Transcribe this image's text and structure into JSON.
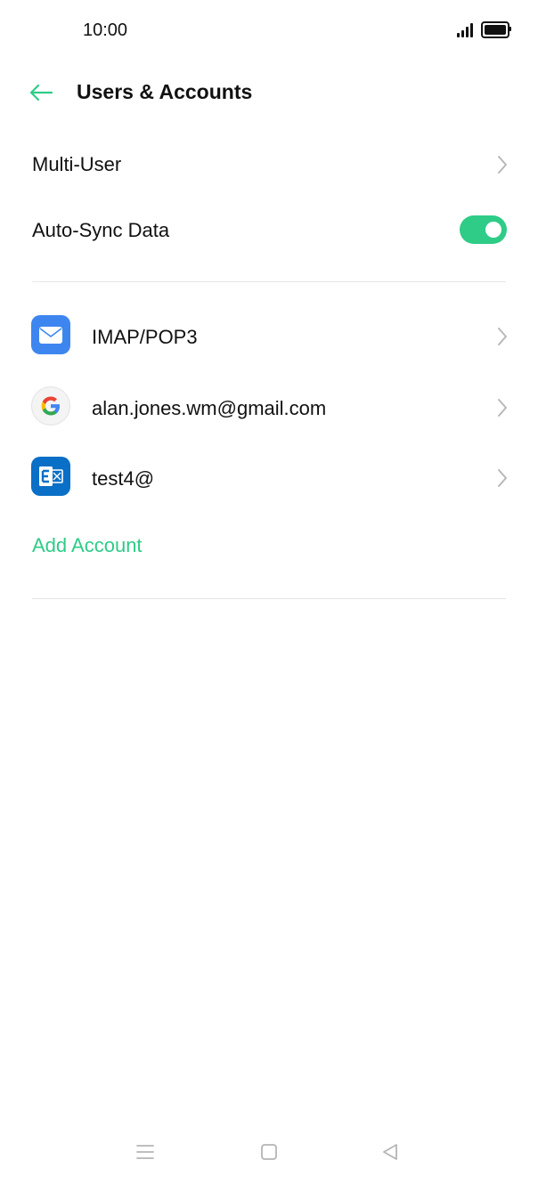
{
  "status_bar": {
    "time": "10:00",
    "signal_icon": "signal-icon",
    "battery_icon": "battery-icon"
  },
  "header": {
    "title": "Users & Accounts",
    "back_icon": "arrow-left-icon"
  },
  "settings": {
    "multi_user_label": "Multi-User",
    "auto_sync_label": "Auto-Sync Data",
    "auto_sync_enabled": true
  },
  "accounts": [
    {
      "label": "IMAP/POP3",
      "icon": "mail-icon"
    },
    {
      "label": "alan.jones.wm@gmail.com",
      "icon": "google-icon"
    },
    {
      "label": "test4@",
      "icon": "exchange-icon"
    }
  ],
  "add_account_label": "Add Account",
  "nav_bar": {
    "menu_icon": "menu-icon",
    "home_icon": "home-icon",
    "back_icon": "back-triangle-icon"
  },
  "colors": {
    "accent": "#2ecc87",
    "mail_blue": "#3d86f0",
    "exchange_blue": "#0a6fc6",
    "divider": "#e6e6e6"
  }
}
